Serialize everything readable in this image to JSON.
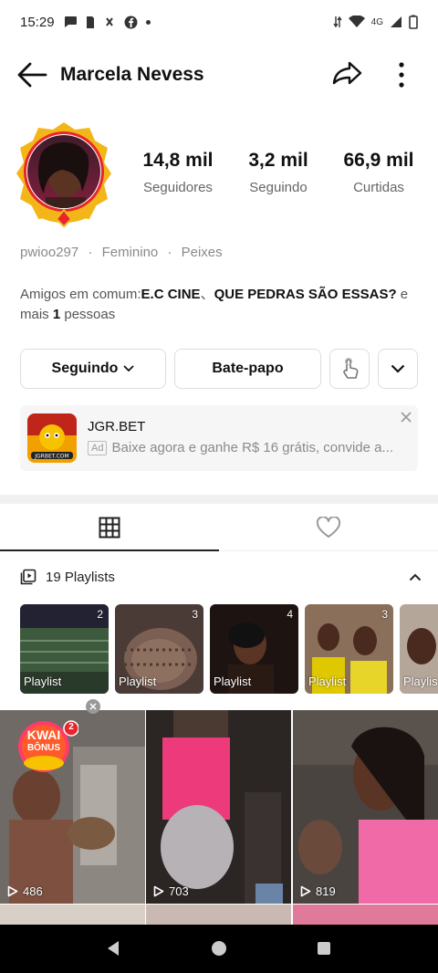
{
  "status": {
    "time": "15:29",
    "network": "4G"
  },
  "header": {
    "title": "Marcela Nevess"
  },
  "stats": [
    {
      "value": "14,8 mil",
      "label": "Seguidores"
    },
    {
      "value": "3,2 mil",
      "label": "Seguindo"
    },
    {
      "value": "66,9 mil",
      "label": "Curtidas"
    }
  ],
  "profile_meta": {
    "username": "pwioo297",
    "sep": "·",
    "gender": "Feminino",
    "sign": "Peixes"
  },
  "mutual": {
    "prefix": "Amigos em comum:",
    "friend1": "E.C CINE",
    "sep": "、",
    "friend2": "QUE PEDRAS SÃO ESSAS?",
    "middle": " e mais ",
    "count": "1",
    "suffix": " pessoas"
  },
  "actions": {
    "following": "Seguindo",
    "chat": "Bate-papo"
  },
  "ad": {
    "brand": "JGR.BET",
    "badge": "Ad",
    "text": "Baixe agora e ganhe R$ 16 grátis, convide a..."
  },
  "playlists": {
    "title": "19 Playlists",
    "items": [
      {
        "label": "Playlist",
        "count": "2"
      },
      {
        "label": "Playlist",
        "count": "3"
      },
      {
        "label": "Playlist",
        "count": "4"
      },
      {
        "label": "Playlist",
        "count": "3"
      },
      {
        "label": "Playlis",
        "count": ""
      }
    ]
  },
  "videos": [
    {
      "views": "486"
    },
    {
      "views": "703"
    },
    {
      "views": "819"
    }
  ],
  "kwai_badge": {
    "text1": "KWAI",
    "text2": "BÔNUS",
    "count": "2"
  },
  "colors": {
    "accent_red": "#e8242c",
    "gold": "#f3b619"
  }
}
